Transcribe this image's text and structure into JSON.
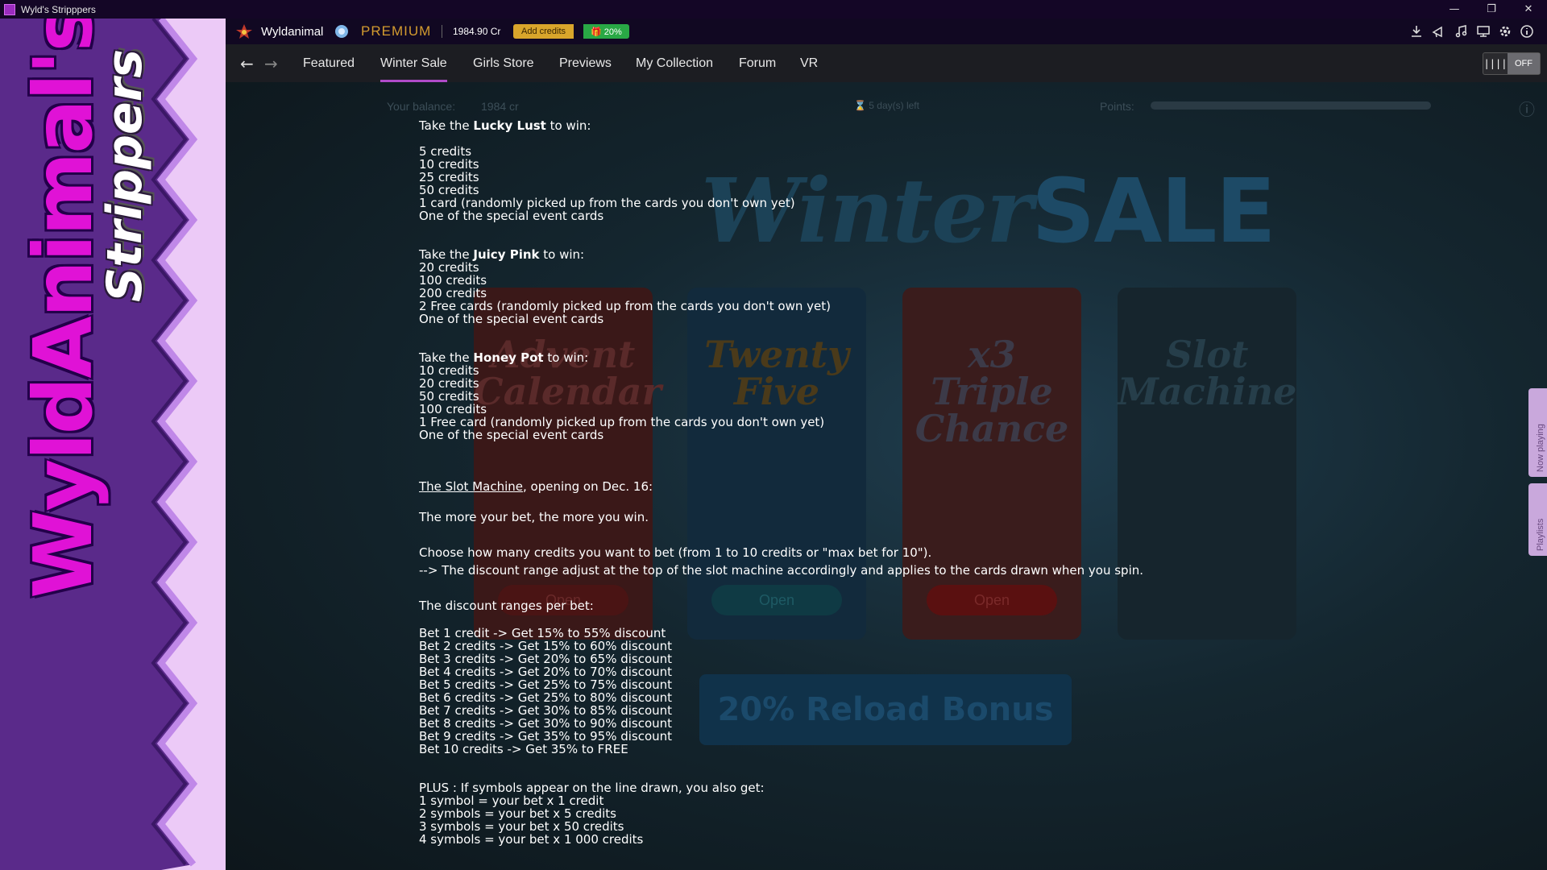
{
  "window": {
    "title": "Wyld's Stripppers",
    "controls": {
      "minimize": "—",
      "restore": "❐",
      "close": "✕"
    }
  },
  "sidebar": {
    "logo_main": "WyldAnimal's",
    "logo_sub": "Strippers"
  },
  "header": {
    "username": "Wyldanimal",
    "premium": "PREMIUM",
    "balance": "1984.90 Cr",
    "add_credits": "Add credits",
    "bonus_pct": "🎁 20%",
    "icons": [
      "download-icon",
      "announcement-icon",
      "music-icon",
      "monitor-icon",
      "settings-icon",
      "info-icon"
    ]
  },
  "nav": {
    "back": "←",
    "forward": "→",
    "tabs": [
      "Featured",
      "Winter Sale",
      "Girls Store",
      "Previews",
      "My Collection",
      "Forum",
      "VR"
    ],
    "active_tab": "Winter Sale",
    "toggle_label": "OFF",
    "toggle_icon": "||||"
  },
  "background": {
    "your_balance_label": "Your balance:",
    "your_balance_value": "1984 cr",
    "days_left": "⌛ 5 day(s) left",
    "points_label": "Points:",
    "title_script": "Winter",
    "title_bold": "SALE",
    "cards": [
      {
        "name": "Advent Calendar",
        "button": "Open",
        "color": "#5a1e1e"
      },
      {
        "name": "Twenty Five",
        "button": "Open",
        "color": "#1b3a56"
      },
      {
        "name": "x3 Triple Chance",
        "button": "Open",
        "color": "#5a2626"
      },
      {
        "name": "Slot Machine",
        "button": "",
        "color": "#1b2c36"
      }
    ],
    "reload_bonus": "20% Reload Bonus"
  },
  "side_tabs": {
    "now_playing": "Now playing",
    "playlists": "Playlists"
  },
  "info": {
    "lucky_lust": {
      "pre": "Take the ",
      "name": "Lucky Lust",
      "post": " to win:",
      "items": [
        "5 credits",
        "10 credits",
        "25 credits",
        "50 credits",
        "1 card (randomly picked up from the cards you don't own yet)",
        "One of the special event cards"
      ]
    },
    "juicy_pink": {
      "pre": "Take the ",
      "name": "Juicy Pink",
      "post": " to win:",
      "items": [
        "20 credits",
        "100 credits",
        "200 credits",
        "2 Free cards (randomly picked up from the cards you don't own yet)",
        "One of the special event cards"
      ]
    },
    "honey_pot": {
      "pre": "Take the ",
      "name": "Honey Pot",
      "post": " to win:",
      "items": [
        "10 credits",
        "20 credits",
        "50 credits",
        "100 credits",
        "1 Free card (randomly picked up from the cards you don't own yet)",
        "One of the special event cards"
      ]
    },
    "slot_link": "The Slot Machine",
    "slot_opening": ", opening on Dec. 16:",
    "more_bet": "The more your bet, the more you win.",
    "choose": "Choose how many credits you want to bet (from 1 to 10 credits or \"max bet for 10\").",
    "discount_note": "--> The discount range adjust at the top of the slot machine accordingly and applies to the cards drawn when you spin.",
    "ranges_title": "The discount ranges per bet:",
    "ranges": [
      "Bet 1 credit -> Get 15% to 55% discount",
      "Bet 2 credits -> Get 15% to 60% discount",
      "Bet 3 credits -> Get 20% to 65% discount",
      "Bet 4 credits -> Get 20% to 70% discount",
      "Bet 5 credits -> Get 25% to 75% discount",
      "Bet 6 credits -> Get 25% to 80% discount",
      "Bet 7 credits -> Get 30% to 85% discount",
      "Bet 8 credits -> Get 30% to 90% discount",
      "Bet 9 credits -> Get 35% to 95% discount",
      "Bet 10 credits -> Get 35% to FREE"
    ],
    "plus_title": "PLUS : If symbols appear on the line drawn, you also get:",
    "symbols": [
      "1 symbol = your bet x 1 credit",
      "2 symbols = your bet x 5 credits",
      "3 symbols = your bet x 50 credits",
      "4 symbols = your bet x 1 000 credits"
    ]
  }
}
